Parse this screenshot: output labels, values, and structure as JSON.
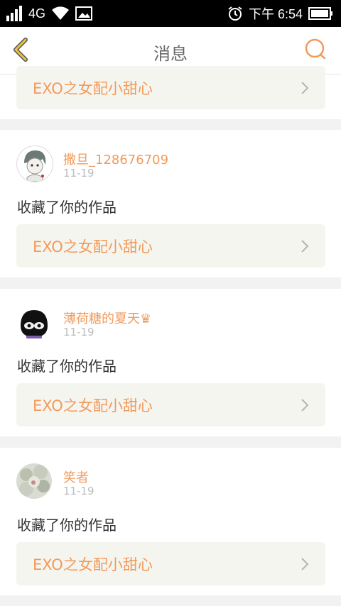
{
  "status_bar": {
    "network": "4G",
    "time": "下午 6:54"
  },
  "header": {
    "title": "消息"
  },
  "top_partial": {
    "work_title": "EXO之女配小甜心"
  },
  "messages": [
    {
      "username": "撒旦_128676709",
      "date": "11-19",
      "action": "收藏了你的作品",
      "work_title": "EXO之女配小甜心"
    },
    {
      "username": "薄荷糖的夏天♛",
      "date": "11-19",
      "action": "收藏了你的作品",
      "work_title": "EXO之女配小甜心"
    },
    {
      "username": "笑者",
      "date": "11-19",
      "action": "收藏了你的作品",
      "work_title": "EXO之女配小甜心"
    }
  ],
  "colors": {
    "accent": "#f29a5c",
    "back_icon": "#f0c43c",
    "work_bg": "#f5f5ef"
  },
  "icons": {
    "back": "chevron-left-icon",
    "search": "search-icon",
    "work_link": "chevron-right-icon"
  }
}
